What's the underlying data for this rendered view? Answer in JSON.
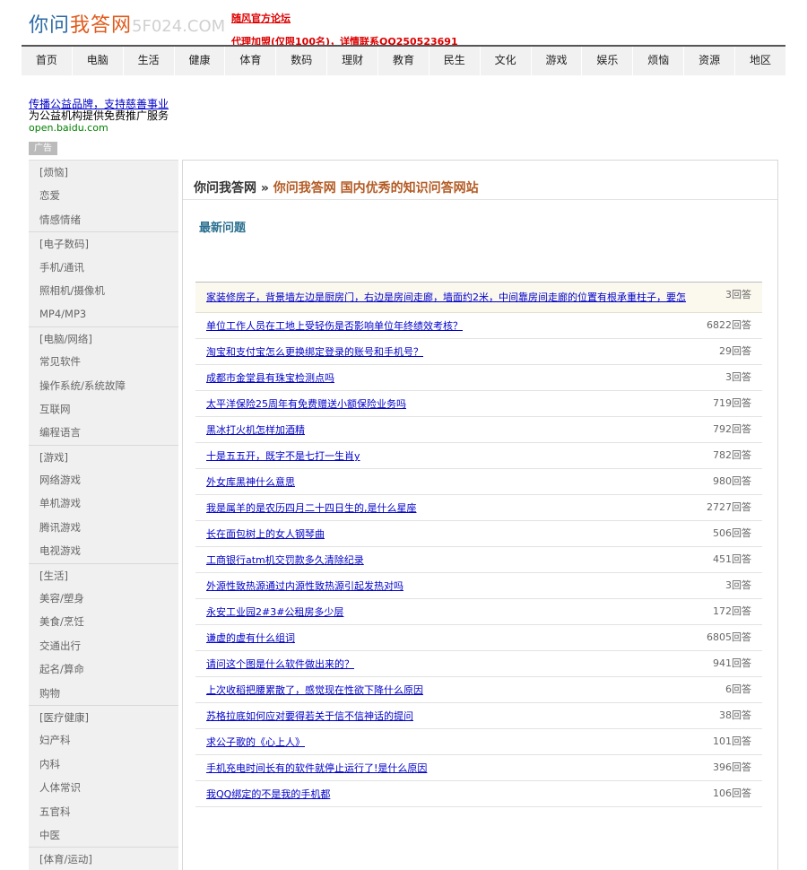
{
  "header": {
    "logo_part1": "你问",
    "logo_part2": "我答网",
    "logo_part3": "5F024.COM",
    "notice1": "随风官方论坛",
    "notice2": "代理加盟(仅限100名)，详情联系QQ250523691"
  },
  "nav": [
    "首页",
    "电脑",
    "生活",
    "健康",
    "体育",
    "数码",
    "理财",
    "教育",
    "民生",
    "文化",
    "游戏",
    "娱乐",
    "烦恼",
    "资源",
    "地区"
  ],
  "promo": {
    "line1": "传播公益品牌，支持慈善事业",
    "line2": "为公益机构提供免费推广服务",
    "line3": "open.baidu.com",
    "ad_label": "广告"
  },
  "sidebar": [
    {
      "text": "[烦恼]",
      "cat": true
    },
    {
      "text": "恋爱",
      "cat": false
    },
    {
      "text": "情感情绪",
      "cat": false
    },
    {
      "text": "[电子数码]",
      "cat": true
    },
    {
      "text": "手机/通讯",
      "cat": false
    },
    {
      "text": "照相机/摄像机",
      "cat": false
    },
    {
      "text": "MP4/MP3",
      "cat": false
    },
    {
      "text": "[电脑/网络]",
      "cat": true
    },
    {
      "text": "常见软件",
      "cat": false
    },
    {
      "text": "操作系统/系统故障",
      "cat": false
    },
    {
      "text": "互联网",
      "cat": false
    },
    {
      "text": "编程语言",
      "cat": false
    },
    {
      "text": "[游戏]",
      "cat": true
    },
    {
      "text": "网络游戏",
      "cat": false
    },
    {
      "text": "单机游戏",
      "cat": false
    },
    {
      "text": "腾讯游戏",
      "cat": false
    },
    {
      "text": "电视游戏",
      "cat": false
    },
    {
      "text": "[生活]",
      "cat": true
    },
    {
      "text": "美容/塑身",
      "cat": false
    },
    {
      "text": "美食/烹饪",
      "cat": false
    },
    {
      "text": "交通出行",
      "cat": false
    },
    {
      "text": "起名/算命",
      "cat": false
    },
    {
      "text": "购物",
      "cat": false
    },
    {
      "text": "[医疗健康]",
      "cat": true
    },
    {
      "text": "妇产科",
      "cat": false
    },
    {
      "text": "内科",
      "cat": false
    },
    {
      "text": "人体常识",
      "cat": false
    },
    {
      "text": "五官科",
      "cat": false
    },
    {
      "text": "中医",
      "cat": false
    },
    {
      "text": "[体育/运动]",
      "cat": true
    }
  ],
  "main": {
    "breadcrumb_home": "你问我答网",
    "breadcrumb_sep": " » ",
    "breadcrumb_current": "你问我答网 国内优秀的知识问答网站",
    "section_title": "最新问题",
    "questions": [
      {
        "title": "家装修房子，背景墙左边是厨房门，右边是房间走廊，墙面约2米，中间靠房间走廊的位置有根承重柱子，要怎",
        "count": "3回答"
      },
      {
        "title": "单位工作人员在工地上受轻伤是否影响单位年终绩效考核？",
        "count": "6822回答"
      },
      {
        "title": "淘宝和支付宝怎么更换绑定登录的账号和手机号？",
        "count": "29回答"
      },
      {
        "title": "成都市金堂县有珠宝检测点吗",
        "count": "3回答"
      },
      {
        "title": "太平洋保险25周年有免费赠送小额保险业务吗",
        "count": "719回答"
      },
      {
        "title": "黑冰打火机怎样加酒精",
        "count": "792回答"
      },
      {
        "title": "十是五五开，既字不是七打一生肖y",
        "count": "782回答"
      },
      {
        "title": "外女库黑神什么意思",
        "count": "980回答"
      },
      {
        "title": "我是属羊的是农历四月二十四日生的,是什么星座",
        "count": "2727回答"
      },
      {
        "title": "长在面包树上的女人钢琴曲",
        "count": "506回答"
      },
      {
        "title": "工商银行atm机交罚款多久清除纪录",
        "count": "451回答"
      },
      {
        "title": "外源性致热源通过内源性致热源引起发热对吗",
        "count": "3回答"
      },
      {
        "title": "永安工业园2#3#公租房多少层",
        "count": "172回答"
      },
      {
        "title": "谦虚的虚有什么组词",
        "count": "6805回答"
      },
      {
        "title": "请问这个图是什么软件做出来的？",
        "count": "941回答"
      },
      {
        "title": "上次收稻把腰累散了，感觉现在性欲下降什么原因",
        "count": "6回答"
      },
      {
        "title": "苏格拉底如何应对要得若关于信不信神话的提问",
        "count": "38回答"
      },
      {
        "title": "求公子歌的《心上人》",
        "count": "101回答"
      },
      {
        "title": "手机充电时间长有的软件就停止运行了!是什么原因",
        "count": "396回答"
      },
      {
        "title": "我QQ绑定的不是我的手机都",
        "count": "106回答"
      }
    ]
  }
}
